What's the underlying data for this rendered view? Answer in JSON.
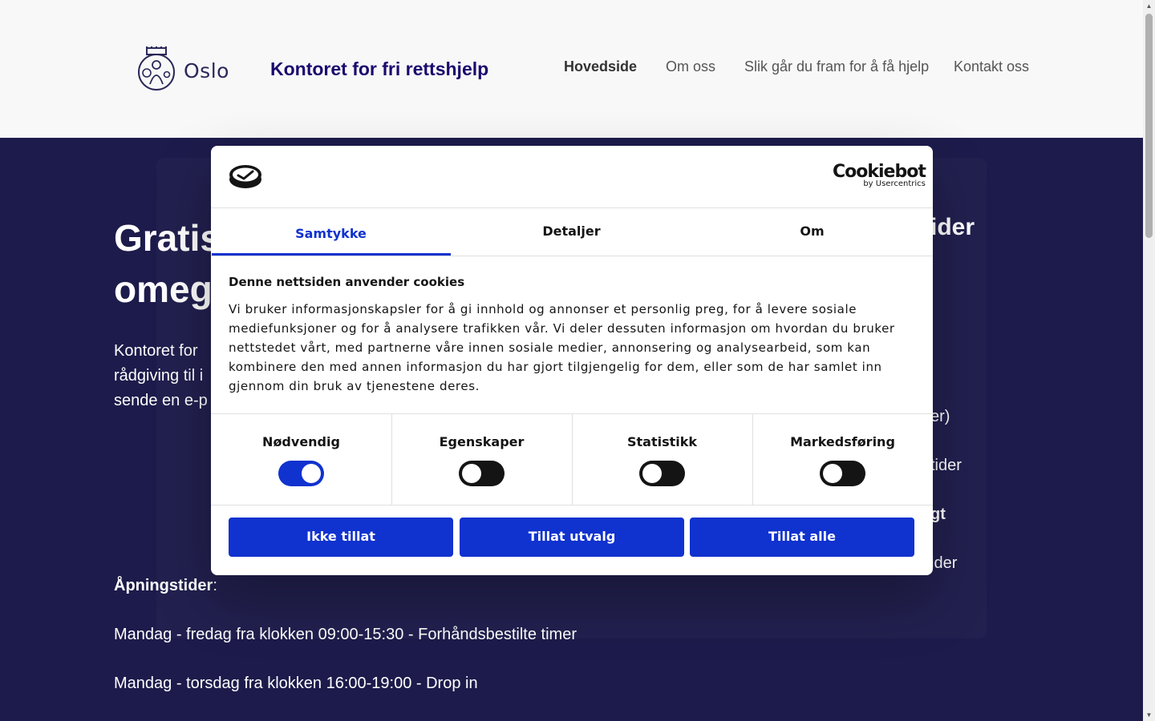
{
  "header": {
    "logo_text": "Oslo",
    "site_title": "Kontoret for fri rettshjelp",
    "nav": [
      {
        "label": "Hovedside",
        "active": true
      },
      {
        "label": "Om oss",
        "active": false
      },
      {
        "label": "Slik går du fram for å få hjelp",
        "active": false
      },
      {
        "label": "Kontakt oss",
        "active": false
      }
    ]
  },
  "hero": {
    "title_line1": "Gratis",
    "title_line2": "omegn",
    "intro_line1": "Kontoret for",
    "intro_line2": "rådgiving til i",
    "intro_line3": "sende en e-p",
    "hours_label": "Åpningstider",
    "hours_colon": ":",
    "hours_1": "Mandag - fredag fra klokken 09:00-15:30 - Forhåndsbestilte timer",
    "hours_2": "Mandag - torsdag fra klokken 16:00-19:00 - Drop in"
  },
  "side": {
    "heading": "ider",
    "line1": "er)",
    "line2": "tider",
    "line3": "gt",
    "line4": "ider"
  },
  "cookie": {
    "brand_name": "Cookiebot",
    "brand_by": "by Usercentrics",
    "tabs": [
      "Samtykke",
      "Detaljer",
      "Om"
    ],
    "heading": "Denne nettsiden anvender cookies",
    "body": "Vi bruker informasjonskapsler for å gi innhold og annonser et personlig preg, for å levere sosiale mediefunksjoner og for å analysere trafikken vår. Vi deler dessuten informasjon om hvordan du bruker nettstedet vårt, med partnerne våre innen sosiale medier, annonsering og analysearbeid, som kan kombinere den med annen informasjon du har gjort tilgjengelig for dem, eller som de har samlet inn gjennom din bruk av tjenestene deres.",
    "categories": [
      {
        "label": "Nødvendig",
        "on": true
      },
      {
        "label": "Egenskaper",
        "on": false
      },
      {
        "label": "Statistikk",
        "on": false
      },
      {
        "label": "Markedsføring",
        "on": false
      }
    ],
    "buttons": {
      "deny": "Ikke tillat",
      "selection": "Tillat utvalg",
      "allow_all": "Tillat alle"
    }
  },
  "colors": {
    "accent": "#1032cf",
    "hero_bg": "#1d1b4b",
    "title_color": "#1a0a6e"
  }
}
